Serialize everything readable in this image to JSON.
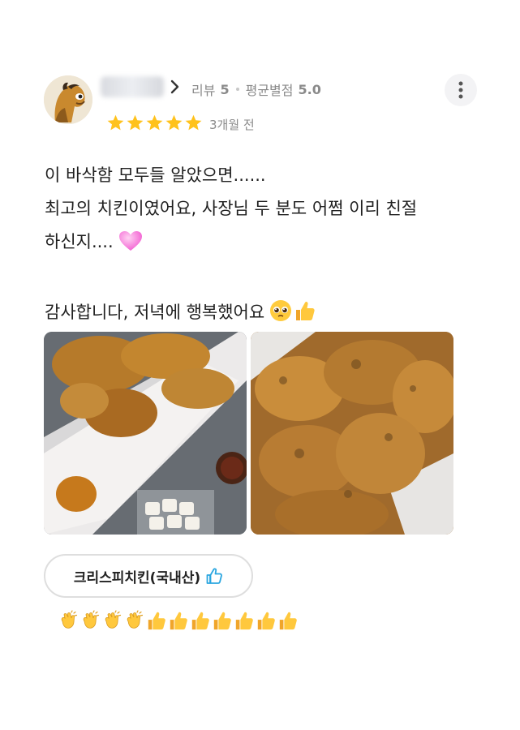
{
  "review": {
    "review_count_label": "리뷰",
    "review_count": "5",
    "avg_rating_label": "평균별점",
    "avg_rating": "5.0",
    "rating_stars": 5,
    "time_ago": "3개월 전",
    "lines": [
      "이 바삭함 모두들 알았으면......",
      "최고의 치킨이였어요, 사장님 두 분도 어쩜 이리 친절",
      "하신지....",
      "감사합니다, 저녁에 행복했어요"
    ],
    "menu_tag": "크리스피치킨(국내산)",
    "emoji_row": [
      "clap",
      "clap",
      "clap",
      "clap",
      "thumbs-up",
      "thumbs-up",
      "thumbs-up",
      "thumbs-up",
      "thumbs-up",
      "thumbs-up",
      "thumbs-up"
    ]
  },
  "colors": {
    "star": "#ffc21c",
    "thumb_outline": "#2aa6e0",
    "meta_text": "#8a8a8a"
  }
}
